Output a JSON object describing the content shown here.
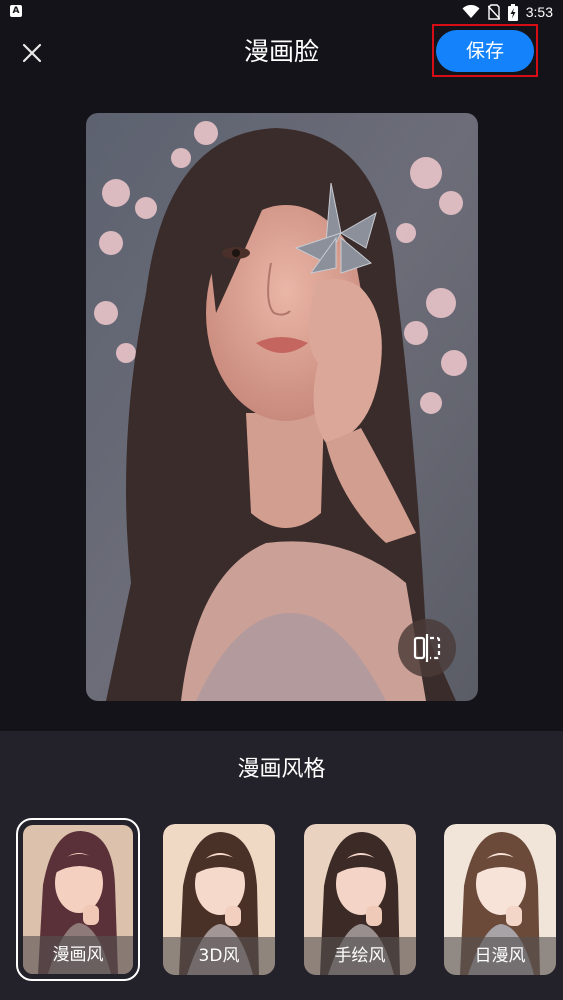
{
  "status_bar": {
    "time": "3:53",
    "app_icon_letter": "A"
  },
  "app_bar": {
    "title": "漫画脸",
    "save_label": "保存"
  },
  "photo": {
    "description_icon": "compare-icon"
  },
  "panel": {
    "title": "漫画风格",
    "styles": [
      {
        "label": "漫画风",
        "selected": true
      },
      {
        "label": "3D风",
        "selected": false
      },
      {
        "label": "手绘风",
        "selected": false
      },
      {
        "label": "日漫风",
        "selected": false
      }
    ]
  },
  "colors": {
    "background": "#141319",
    "panel": "#23222a",
    "accent": "#1483fb",
    "highlight": "#d60d16"
  }
}
